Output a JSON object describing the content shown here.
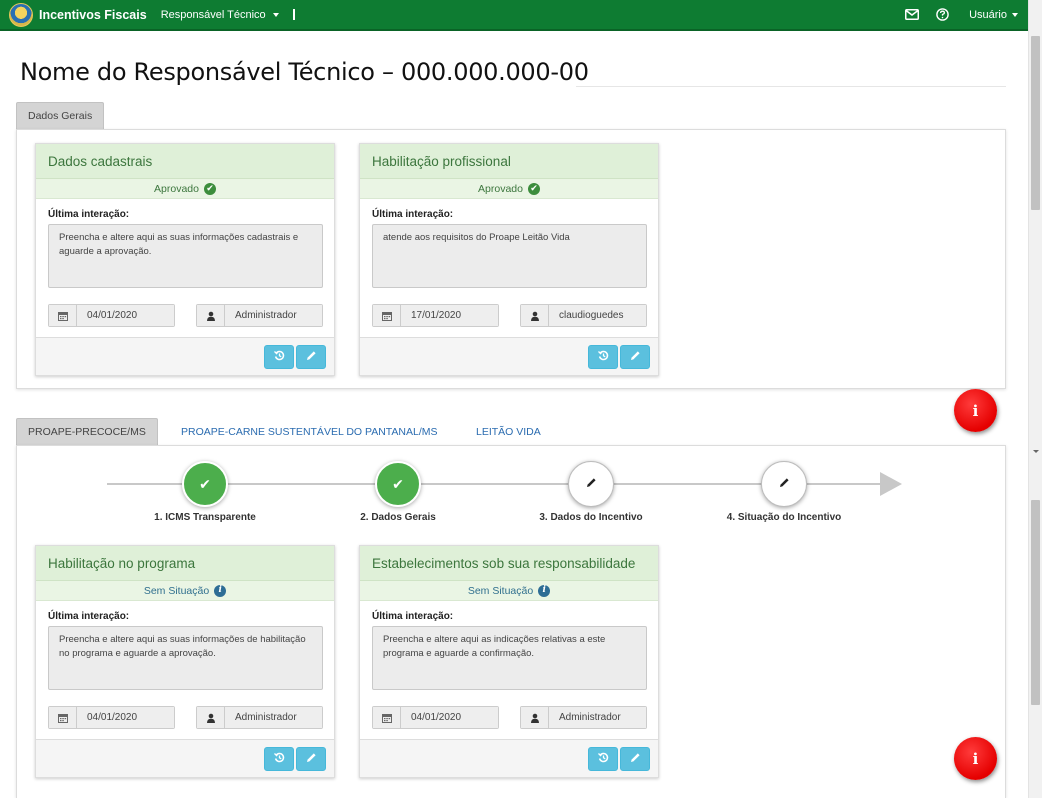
{
  "navbar": {
    "brand": "Incentivos Fiscais",
    "menu_label": "Responsável Técnico",
    "user_label": "Usuário"
  },
  "page_title": "Nome do Responsável Técnico – 000.000.000-00",
  "general_tab": "Dados Gerais",
  "general_cards": [
    {
      "title": "Dados cadastrais",
      "status": "Aprovado",
      "interaction_label": "Última interação:",
      "text": "Preencha e altere aqui as suas informações cadastrais e aguarde a aprovação.",
      "date": "04/01/2020",
      "user": "Administrador"
    },
    {
      "title": "Habilitação profissional",
      "status": "Aprovado",
      "interaction_label": "Última interação:",
      "text": "atende aos requisitos do Proape Leitão Vida",
      "date": "17/01/2020",
      "user": "claudioguedes"
    }
  ],
  "program_tabs": [
    "PROAPE-PRECOCE/MS",
    "PROAPE-CARNE SUSTENTÁVEL DO PANTANAL/MS",
    "LEITÃO VIDA"
  ],
  "steps": [
    {
      "label": "1. ICMS Transparente",
      "state": "done"
    },
    {
      "label": "2. Dados Gerais",
      "state": "done"
    },
    {
      "label": "3. Dados do Incentivo",
      "state": "pending"
    },
    {
      "label": "4. Situação do Incentivo",
      "state": "pending"
    }
  ],
  "program_cards": [
    {
      "title": "Habilitação no programa",
      "status": "Sem Situação",
      "interaction_label": "Última interação:",
      "text": "Preencha e altere aqui as suas informações de habilitação no programa e aguarde a aprovação.",
      "date": "04/01/2020",
      "user": "Administrador"
    },
    {
      "title": "Estabelecimentos sob sua responsabilidade",
      "status": "Sem Situação",
      "interaction_label": "Última interação:",
      "text": "Preencha e altere aqui as indicações relativas a este programa e aguarde a confirmação.",
      "date": "04/01/2020",
      "user": "Administrador"
    }
  ],
  "icons": {
    "check": "✔",
    "info": "i",
    "pencil": "pencil-icon",
    "history": "history-icon",
    "calendar": "calendar-icon",
    "user": "user-icon",
    "mail": "mail-icon",
    "help": "help-icon"
  },
  "colors": {
    "navbar": "#0e7c32",
    "card_header": "#dff0d8",
    "step_done": "#4cae4c",
    "action_button": "#5bc0de",
    "info_bubble": "#e50000"
  }
}
